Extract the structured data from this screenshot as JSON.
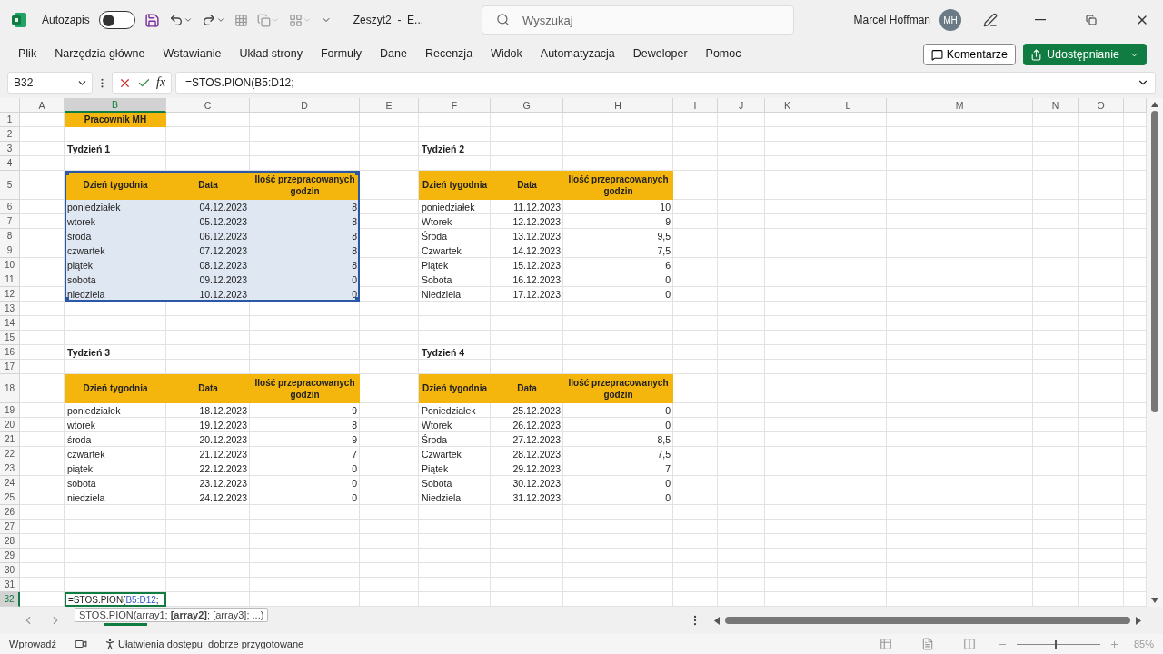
{
  "title_bar": {
    "autosave_label": "Autozapis",
    "autosave_on": false,
    "document_title": "Zeszyt2  -  E...",
    "search_placeholder": "Wyszukaj",
    "user_name": "Marcel Hoffman",
    "avatar_initials": "MH"
  },
  "ribbon_tabs": [
    {
      "label": "Plik",
      "selected": false
    },
    {
      "label": "Narzędzia główne",
      "selected": false
    },
    {
      "label": "Wstawianie",
      "selected": false
    },
    {
      "label": "Układ strony",
      "selected": false
    },
    {
      "label": "Formuły",
      "selected": false
    },
    {
      "label": "Dane",
      "selected": false
    },
    {
      "label": "Recenzja",
      "selected": false
    },
    {
      "label": "Widok",
      "selected": false
    },
    {
      "label": "Automatyzacja",
      "selected": false
    },
    {
      "label": "Deweloper",
      "selected": false
    },
    {
      "label": "Pomoc",
      "selected": false
    }
  ],
  "ribbon_buttons": {
    "comments": "Komentarze",
    "share": "Udostępnianie"
  },
  "formula_bar": {
    "name_box": "B32",
    "fx_label": "fx",
    "formula": "=STOS.PION(B5:D12;"
  },
  "columns": [
    {
      "label": "A",
      "selected": false
    },
    {
      "label": "B",
      "selected": true
    },
    {
      "label": "C",
      "selected": false
    },
    {
      "label": "D",
      "selected": false
    },
    {
      "label": "E",
      "selected": false
    },
    {
      "label": "F",
      "selected": false
    },
    {
      "label": "G",
      "selected": false
    },
    {
      "label": "H",
      "selected": false
    },
    {
      "label": "I",
      "selected": false
    },
    {
      "label": "J",
      "selected": false
    },
    {
      "label": "K",
      "selected": false
    },
    {
      "label": "L",
      "selected": false
    },
    {
      "label": "M",
      "selected": false
    },
    {
      "label": "N",
      "selected": false
    },
    {
      "label": "O",
      "selected": false
    }
  ],
  "rows": [
    {
      "label": "1",
      "selected": false
    },
    {
      "label": "2",
      "selected": false
    },
    {
      "label": "3",
      "selected": false
    },
    {
      "label": "4",
      "selected": false
    },
    {
      "label": "5",
      "selected": false
    },
    {
      "label": "6",
      "selected": false
    },
    {
      "label": "7",
      "selected": false
    },
    {
      "label": "8",
      "selected": false
    },
    {
      "label": "9",
      "selected": false
    },
    {
      "label": "10",
      "selected": false
    },
    {
      "label": "11",
      "selected": false
    },
    {
      "label": "12",
      "selected": false
    },
    {
      "label": "13",
      "selected": false
    },
    {
      "label": "14",
      "selected": false
    },
    {
      "label": "15",
      "selected": false
    },
    {
      "label": "16",
      "selected": false
    },
    {
      "label": "17",
      "selected": false
    },
    {
      "label": "18",
      "selected": false
    },
    {
      "label": "19",
      "selected": false
    },
    {
      "label": "20",
      "selected": false
    },
    {
      "label": "21",
      "selected": false
    },
    {
      "label": "22",
      "selected": false
    },
    {
      "label": "23",
      "selected": false
    },
    {
      "label": "24",
      "selected": false
    },
    {
      "label": "25",
      "selected": false
    },
    {
      "label": "26",
      "selected": false
    },
    {
      "label": "27",
      "selected": false
    },
    {
      "label": "28",
      "selected": false
    },
    {
      "label": "29",
      "selected": false
    },
    {
      "label": "30",
      "selected": false
    },
    {
      "label": "31",
      "selected": false
    },
    {
      "label": "32",
      "selected": true
    }
  ],
  "title_cell": "Pracownik MH",
  "weeks": [
    {
      "title": "Tydzień 1",
      "selected": true,
      "headers": [
        "Dzień tygodnia",
        "Data",
        "Ilość przepracowanych godzin"
      ],
      "rows": [
        [
          "poniedziałek",
          "04.12.2023",
          "8"
        ],
        [
          "wtorek",
          "05.12.2023",
          "8"
        ],
        [
          "środa",
          "06.12.2023",
          "8"
        ],
        [
          "czwartek",
          "07.12.2023",
          "8"
        ],
        [
          "piątek",
          "08.12.2023",
          "8"
        ],
        [
          "sobota",
          "09.12.2023",
          "0"
        ],
        [
          "niedziela",
          "10.12.2023",
          "0"
        ]
      ]
    },
    {
      "title": "Tydzień 2",
      "selected": false,
      "headers": [
        "Dzień tygodnia",
        "Data",
        "Ilość przepracowanych godzin"
      ],
      "rows": [
        [
          "poniedziałek",
          "11.12.2023",
          "10"
        ],
        [
          "Wtorek",
          "12.12.2023",
          "9"
        ],
        [
          "Środa",
          "13.12.2023",
          "9,5"
        ],
        [
          "Czwartek",
          "14.12.2023",
          "7,5"
        ],
        [
          "Piątek",
          "15.12.2023",
          "6"
        ],
        [
          "Sobota",
          "16.12.2023",
          "0"
        ],
        [
          "Niedziela",
          "17.12.2023",
          "0"
        ]
      ]
    },
    {
      "title": "Tydzień 3",
      "selected": false,
      "headers": [
        "Dzień tygodnia",
        "Data",
        "Ilość przepracowanych godzin"
      ],
      "rows": [
        [
          "poniedziałek",
          "18.12.2023",
          "9"
        ],
        [
          "wtorek",
          "19.12.2023",
          "8"
        ],
        [
          "środa",
          "20.12.2023",
          "9"
        ],
        [
          "czwartek",
          "21.12.2023",
          "7"
        ],
        [
          "piątek",
          "22.12.2023",
          "0"
        ],
        [
          "sobota",
          "23.12.2023",
          "0"
        ],
        [
          "niedziela",
          "24.12.2023",
          "0"
        ]
      ]
    },
    {
      "title": "Tydzień 4",
      "selected": false,
      "headers": [
        "Dzień tygodnia",
        "Data",
        "Ilość przepracowanych godzin"
      ],
      "rows": [
        [
          "Poniedziałek",
          "25.12.2023",
          "0"
        ],
        [
          "Wtorek",
          "26.12.2023",
          "0"
        ],
        [
          "Środa",
          "27.12.2023",
          "8,5"
        ],
        [
          "Czwartek",
          "28.12.2023",
          "7,5"
        ],
        [
          "Piątek",
          "29.12.2023",
          "7"
        ],
        [
          "Sobota",
          "30.12.2023",
          "0"
        ],
        [
          "Niedziela",
          "31.12.2023",
          "0"
        ]
      ]
    }
  ],
  "active_cell": {
    "prefix": "=STOS.PION(",
    "reference": "B5:D12",
    "suffix": ";"
  },
  "function_tooltip": "STOS.PION(array1; **[array2]**; [array3]; ...)",
  "status_bar": {
    "mode": "Wprowadź",
    "accessibility": "Ułatwienia dostępu: dobrze przygotowane",
    "zoom_slider": {
      "level": 0.46
    },
    "zoom": "85%"
  }
}
